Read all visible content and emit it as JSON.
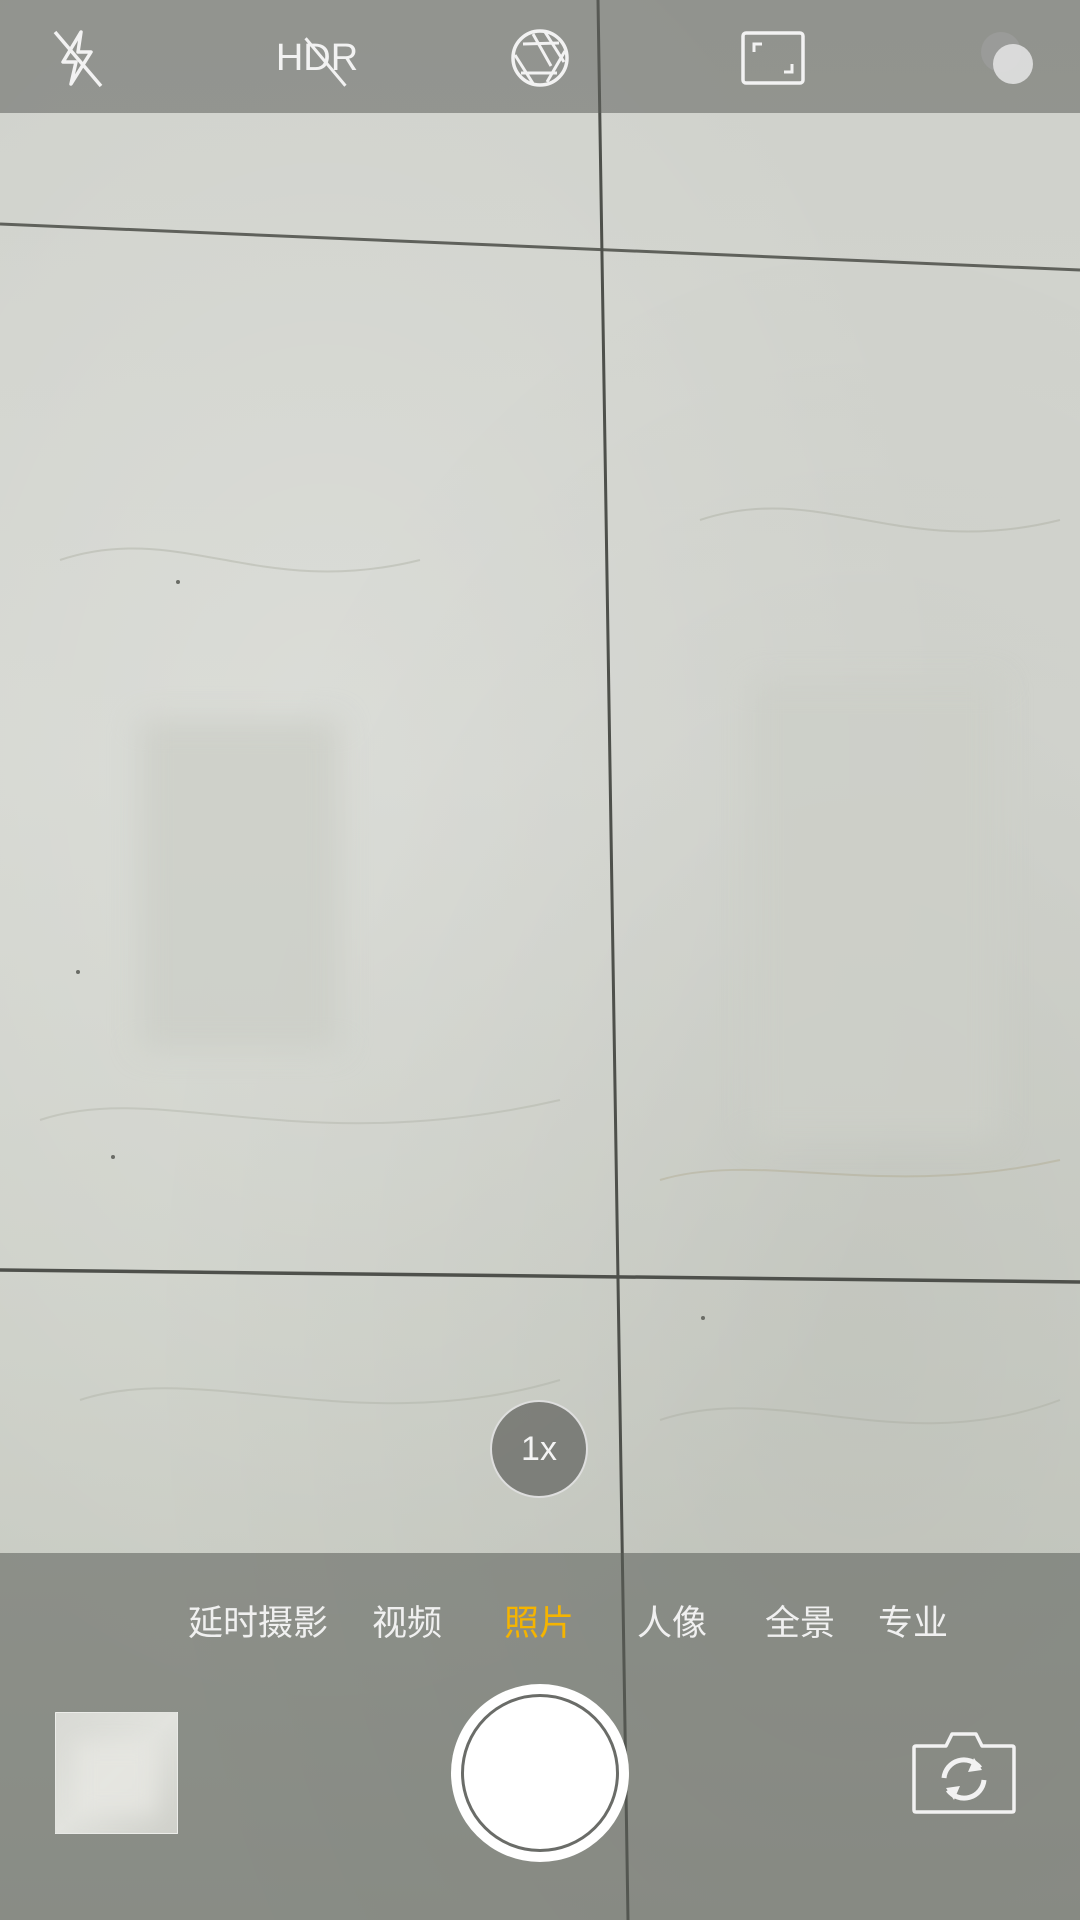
{
  "top_bar": {
    "flash": {
      "icon": "flash-off-icon",
      "state": "off"
    },
    "hdr": {
      "label": "HDR",
      "icon": "hdr-off-icon",
      "state": "off"
    },
    "aperture": {
      "icon": "aperture-icon"
    },
    "aspect_ratio": {
      "icon": "aspect-ratio-icon"
    },
    "filters": {
      "icon": "filter-circles-icon"
    }
  },
  "zoom": {
    "label": "1x"
  },
  "modes": [
    {
      "label": "延时摄影",
      "active": false
    },
    {
      "label": "视频",
      "active": false
    },
    {
      "label": "照片",
      "active": true
    },
    {
      "label": "人像",
      "active": false
    },
    {
      "label": "全景",
      "active": false
    },
    {
      "label": "专业",
      "active": false
    }
  ],
  "colors": {
    "active_mode": "#f5b400",
    "inactive_mode": "#f0f0f0",
    "shutter": "#ffffff"
  },
  "controls": {
    "gallery": {
      "icon": "gallery-thumbnail"
    },
    "shutter": {
      "icon": "shutter-button"
    },
    "switch_camera": {
      "icon": "switch-camera-icon"
    }
  }
}
